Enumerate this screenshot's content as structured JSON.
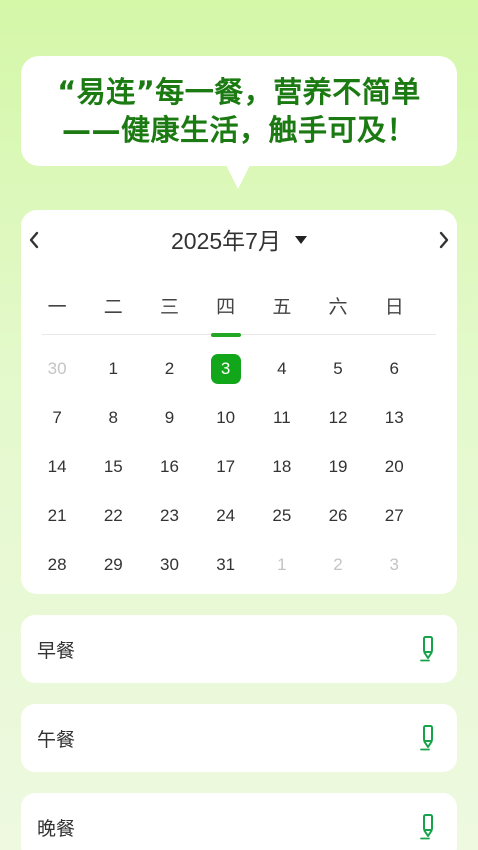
{
  "slogan": {
    "line1": "“易连”每一餐，营养不简单",
    "line2": "——健康生活，触手可及！"
  },
  "calendar": {
    "month_label": "2025年7月",
    "weekdays": [
      "一",
      "二",
      "三",
      "四",
      "五",
      "六",
      "日"
    ],
    "selected_day": "3",
    "highlighted_weekday": "四",
    "days": [
      {
        "d": "30",
        "current": false
      },
      {
        "d": "1",
        "current": true
      },
      {
        "d": "2",
        "current": true
      },
      {
        "d": "3",
        "current": true,
        "selected": true
      },
      {
        "d": "4",
        "current": true
      },
      {
        "d": "5",
        "current": true
      },
      {
        "d": "6",
        "current": true
      },
      {
        "d": "7",
        "current": true
      },
      {
        "d": "8",
        "current": true
      },
      {
        "d": "9",
        "current": true
      },
      {
        "d": "10",
        "current": true
      },
      {
        "d": "11",
        "current": true
      },
      {
        "d": "12",
        "current": true
      },
      {
        "d": "13",
        "current": true
      },
      {
        "d": "14",
        "current": true
      },
      {
        "d": "15",
        "current": true
      },
      {
        "d": "16",
        "current": true
      },
      {
        "d": "17",
        "current": true
      },
      {
        "d": "18",
        "current": true
      },
      {
        "d": "19",
        "current": true
      },
      {
        "d": "20",
        "current": true
      },
      {
        "d": "21",
        "current": true
      },
      {
        "d": "22",
        "current": true
      },
      {
        "d": "23",
        "current": true
      },
      {
        "d": "24",
        "current": true
      },
      {
        "d": "25",
        "current": true
      },
      {
        "d": "26",
        "current": true
      },
      {
        "d": "27",
        "current": true
      },
      {
        "d": "28",
        "current": true
      },
      {
        "d": "29",
        "current": true
      },
      {
        "d": "30",
        "current": true
      },
      {
        "d": "31",
        "current": true
      },
      {
        "d": "1",
        "current": false
      },
      {
        "d": "2",
        "current": false
      },
      {
        "d": "3",
        "current": false
      }
    ]
  },
  "meals": [
    {
      "label": "早餐",
      "icon": "edit-pen-icon"
    },
    {
      "label": "午餐",
      "icon": "edit-pen-icon"
    },
    {
      "label": "晚餐",
      "icon": "edit-pen-icon"
    }
  ],
  "colors": {
    "accent": "#12a61a",
    "slogan": "#1c7a12",
    "background_top": "#d4f7a8",
    "muted_day": "#c4c4c4"
  }
}
